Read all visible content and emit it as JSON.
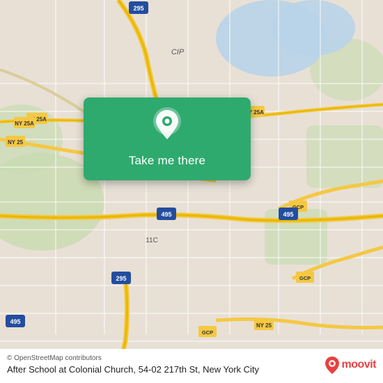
{
  "map": {
    "background_color": "#e8e0d5",
    "attribution": "© OpenStreetMap contributors",
    "location_title": "After School at Colonial Church, 54-02 217th St, New York City"
  },
  "button": {
    "label": "Take me there",
    "bg_color": "#2eaa6e",
    "text_color": "#ffffff"
  },
  "moovit": {
    "name": "moovit",
    "pin_color": "#e84040"
  }
}
